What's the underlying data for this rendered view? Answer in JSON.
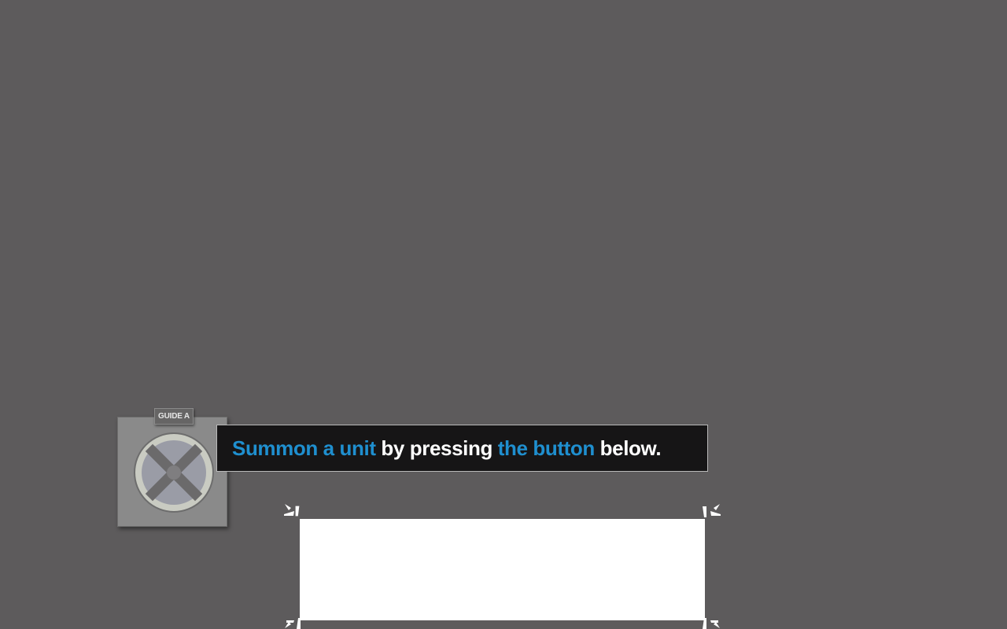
{
  "guide": {
    "tag_label": "GUIDE A",
    "portrait_icon": "x-cross-icon"
  },
  "dialog": {
    "part1": "Summon a unit",
    "part2": " by pressing ",
    "part3": "the button",
    "part4": " below."
  },
  "colors": {
    "background": "#5d5b5c",
    "highlight": "#1f8fcf",
    "dialog_bg": "#161516",
    "target": "#ffffff"
  },
  "target": {
    "marker_icon": "corner-bracket-icon"
  }
}
